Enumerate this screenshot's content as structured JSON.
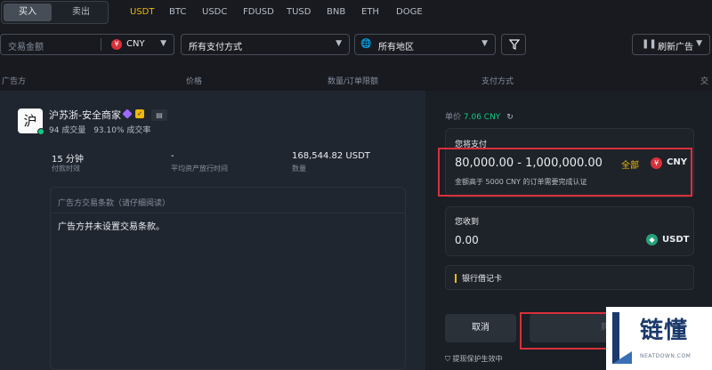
{
  "tabs": {
    "buy": "买入",
    "sell": "卖出"
  },
  "coins": [
    "USDT",
    "BTC",
    "USDC",
    "FDUSD",
    "TUSD",
    "BNB",
    "ETH",
    "DOGE"
  ],
  "active_coin_index": 0,
  "filters": {
    "amount_placeholder": "交易金额",
    "currency": "CNY",
    "currency_icon": "¥",
    "payment": "所有支付方式",
    "region": "所有地区",
    "refresh": "刷新广告"
  },
  "columns": [
    "广告方",
    "价格",
    "数量/订单限额",
    "支付方式",
    "交"
  ],
  "merchant": {
    "avatar": "沪",
    "name": "沪苏浙-安全商家",
    "orders": "94 成交量",
    "completion": "93.10% 成交率"
  },
  "stats": [
    {
      "value": "15 分钟",
      "label": "付款时效"
    },
    {
      "value": "-",
      "label": "平均资产放行时间"
    },
    {
      "value": "168,544.82 USDT",
      "label": "数量"
    }
  ],
  "terms": {
    "title": "广告方交易条款（请仔细阅读）",
    "body": "广告方并未设置交易条款。"
  },
  "order": {
    "unit_label": "单价",
    "unit_price": "7.06 CNY",
    "pay_label": "您将支付",
    "pay_amount": "80,000.00 - 1,000,000.00",
    "all_label": "全部",
    "pay_currency": "CNY",
    "pay_hint": "金额高于 5000 CNY 的订单需要完成认证",
    "receive_label": "您收到",
    "receive_amount": "0.00",
    "receive_currency": "USDT",
    "bank": "银行借记卡",
    "cancel": "取消",
    "buy": "购买",
    "protect": "提现保护生效中"
  },
  "watermark": {
    "cn": "链懂",
    "en": "NEATDOWN.COM"
  },
  "colors": {
    "accent": "#f0b90b",
    "green": "#0ecb81",
    "alert_frame": "#d9303a",
    "bg": "#181a20"
  }
}
